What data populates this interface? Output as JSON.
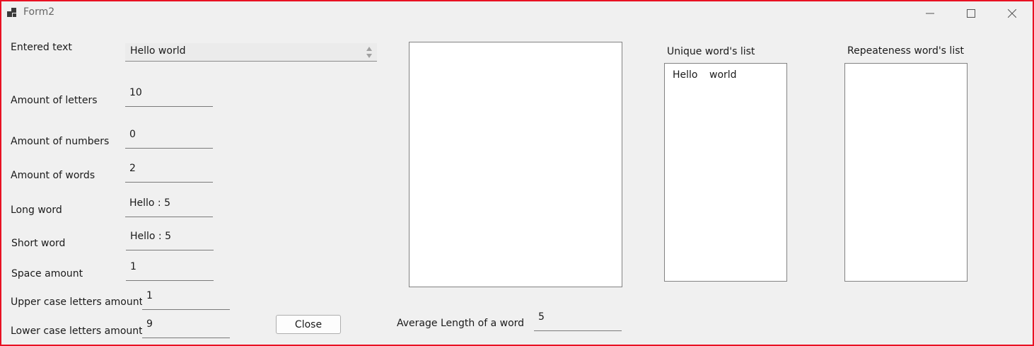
{
  "window": {
    "title": "Form2"
  },
  "labels": {
    "entered_text": "Entered text",
    "amount_letters": "Amount of letters",
    "amount_numbers": "Amount of numbers",
    "amount_words": "Amount of words",
    "long_word": "Long word",
    "short_word": "Short word",
    "space_amount": "Space amount",
    "upper_case": "Upper case letters amount",
    "lower_case": "Lower case letters amount",
    "average_length": "Average Length of a word",
    "unique_list": "Unique word's list",
    "repeat_list": "Repeateness word's list"
  },
  "values": {
    "entered_text": "Hello world",
    "amount_letters": "10",
    "amount_numbers": "0",
    "amount_words": "2",
    "long_word": "Hello : 5",
    "short_word": "Hello : 5",
    "space_amount": "1",
    "upper_case": "1",
    "lower_case": "9",
    "average_length": "5"
  },
  "unique_words": [
    "Hello",
    "world"
  ],
  "buttons": {
    "close": "Close"
  },
  "colors": {
    "window_border": "#e81123",
    "form_bg": "#f0f0f0"
  },
  "icons": {
    "app": "app-icon",
    "minimize": "minimize-icon",
    "maximize": "maximize-icon",
    "close": "close-icon"
  }
}
